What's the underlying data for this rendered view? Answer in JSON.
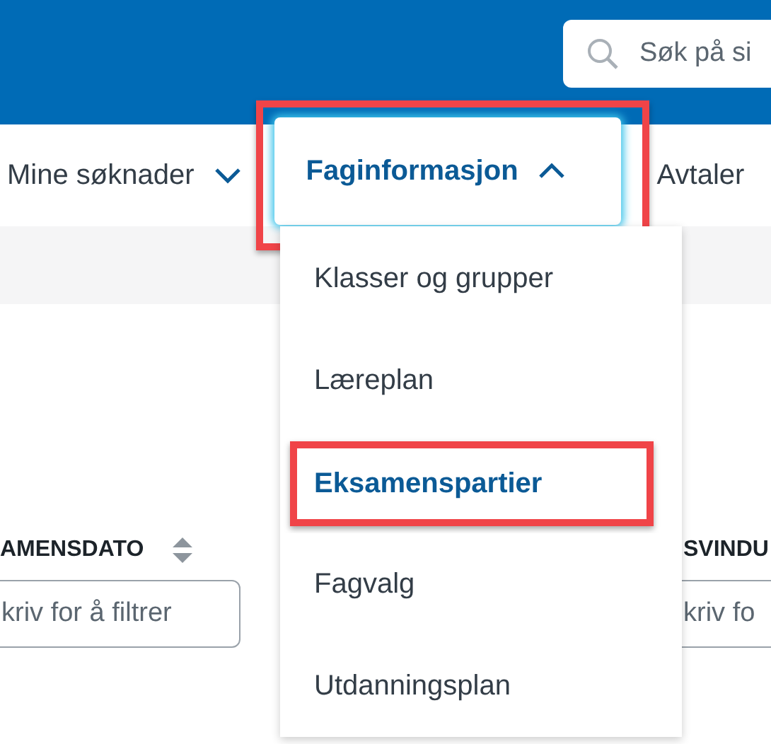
{
  "header": {
    "search": {
      "placeholder": "Søk på si"
    }
  },
  "nav": [
    {
      "label": "Mine søknader",
      "kind": "menu",
      "expanded": false,
      "highlighted": false
    },
    {
      "label": "Faginformasjon",
      "kind": "menu",
      "expanded": true,
      "highlighted": true
    },
    {
      "label": "Avtaler",
      "kind": "link",
      "expanded": false,
      "highlighted": false
    }
  ],
  "dropdown": [
    {
      "label": "Klasser og grupper",
      "selected": false,
      "highlighted": false
    },
    {
      "label": "Læreplan",
      "selected": false,
      "highlighted": false
    },
    {
      "label": "Eksamenspartier",
      "selected": true,
      "highlighted": true
    },
    {
      "label": "Fagvalg",
      "selected": false,
      "highlighted": false
    },
    {
      "label": "Utdanningsplan",
      "selected": false,
      "highlighted": false
    }
  ],
  "table": {
    "columns": [
      {
        "label": "AMENSDATO",
        "sortable": true,
        "filter_placeholder": "kriv for å filtrer"
      },
      {
        "label": "SVINDU",
        "sortable": false,
        "filter_placeholder": "kriv fo"
      }
    ]
  }
}
